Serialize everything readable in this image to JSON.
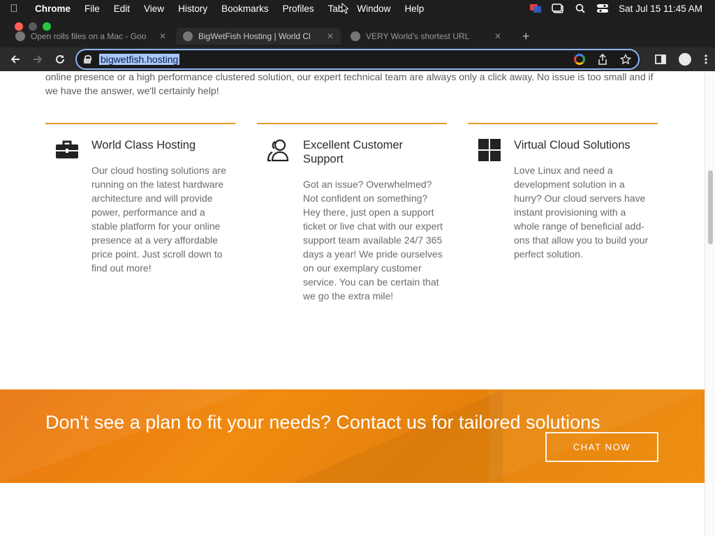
{
  "menubar": {
    "app_name": "Chrome",
    "items": [
      "File",
      "Edit",
      "View",
      "History",
      "Bookmarks",
      "Profiles",
      "Tab",
      "Window",
      "Help"
    ],
    "clock": "Sat Jul 15  11:45 AM"
  },
  "browser": {
    "tabs": [
      {
        "title": "Open rolls files on a Mac - Goo"
      },
      {
        "title": "BigWetFish Hosting | World Cl"
      },
      {
        "title": "VERY World's shortest URL"
      }
    ],
    "url": "bigwetfish.hosting"
  },
  "page": {
    "intro": "online presence or a high performance clustered solution, our expert technical team are always only a click away. No issue is too small and if we have the answer, we'll certainly help!",
    "features": [
      {
        "icon": "briefcase-icon",
        "title": "World Class Hosting",
        "text": "Our cloud hosting solutions are running on the latest hardware architecture and will provide power, performance and a stable platform for your online presence at a very affordable price point. Just scroll down to find out more!"
      },
      {
        "icon": "users-icon",
        "title": "Excellent Customer Support",
        "text": "Got an issue? Overwhelmed? Not confident on something? Hey there, just open a support ticket or live chat with our expert support team available 24/7 365 days a year! We pride ourselves on our exemplary customer service. You can be certain that we go the extra mile!"
      },
      {
        "icon": "grid-icon",
        "title": "Virtual Cloud Solutions",
        "text": "Love Linux and need a development solution in a hurry? Our cloud servers have instant provisioning with a whole range of beneficial add-ons that allow you to build your perfect solution."
      }
    ],
    "banner": {
      "heading": "Don't see a plan to fit your needs? Contact us for tailored solutions",
      "button": "CHAT NOW"
    }
  },
  "colors": {
    "accent": "#e3992f",
    "banner": "#ed840f"
  }
}
